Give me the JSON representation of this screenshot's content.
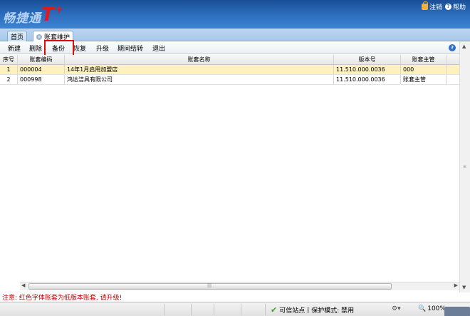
{
  "header": {
    "logo_cn": "畅捷通",
    "logo_t": "T",
    "logo_plus": "+",
    "logout_label": "注销",
    "help_label": "帮助"
  },
  "tabs": [
    {
      "label": "首页"
    },
    {
      "label": "账套维护"
    }
  ],
  "toolbar": {
    "buttons": [
      "新建",
      "删除",
      "备份",
      "恢复",
      "升级",
      "期间结转",
      "退出"
    ],
    "highlighted": "备份"
  },
  "table": {
    "columns": [
      "序号",
      "账套编码",
      "账套名称",
      "版本号",
      "账套主管"
    ],
    "rows": [
      {
        "idx": "1",
        "code": "000004",
        "name": "14年1月启用加盟店",
        "version": "11.510.000.0036",
        "owner": "000",
        "selected": true
      },
      {
        "idx": "2",
        "code": "000998",
        "name": "鸿达洁具有限公司",
        "version": "11.510.000.0036",
        "owner": "账套主管",
        "selected": false
      }
    ]
  },
  "note": "注意: 红色字体账套为低版本账套, 请升级!",
  "status": {
    "trusted": "可信站点",
    "separator": "|",
    "protected": "保护模式: 禁用",
    "zoom": "100%"
  },
  "colors": {
    "header_blue": "#2d6fbf",
    "highlight_red": "#e00c0c",
    "selected_row": "#fdf2bd",
    "note_red": "#c00000"
  }
}
